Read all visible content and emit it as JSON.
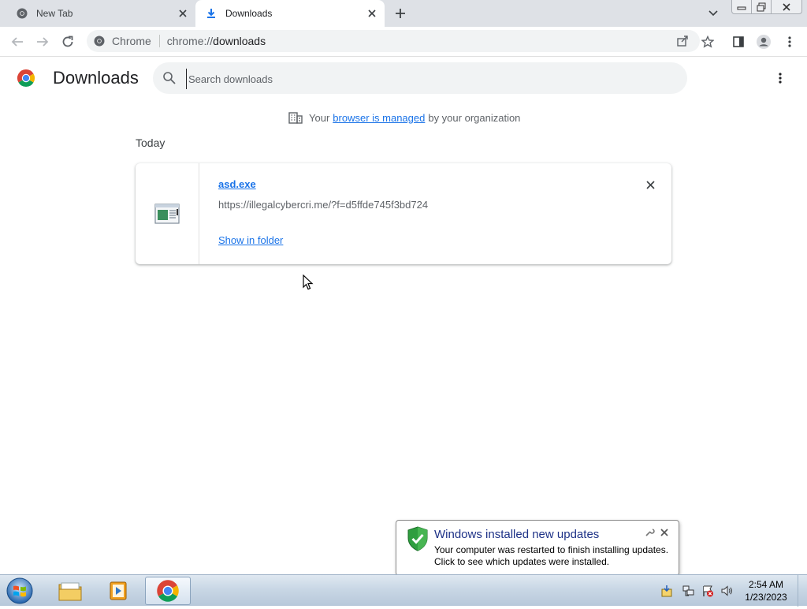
{
  "browser": {
    "tabs": [
      {
        "title": "New Tab",
        "icon": "chrome-icon",
        "active": false
      },
      {
        "title": "Downloads",
        "icon": "download-icon",
        "active": true
      }
    ],
    "new_tab_icon": "plus-icon",
    "tab_search_icon": "chevron-down-icon",
    "window_controls": [
      "minimize-icon",
      "restore-icon",
      "close-icon"
    ]
  },
  "toolbar": {
    "back_icon": "back-arrow-icon",
    "forward_icon": "forward-arrow-icon",
    "reload_icon": "reload-icon",
    "site_chip": "Chrome",
    "url_scheme": "chrome://",
    "url_host": "downloads",
    "right_icons": [
      "share-icon",
      "star-icon",
      "side-panel-icon",
      "profile-icon",
      "kebab-menu-icon"
    ]
  },
  "downloads_page": {
    "title": "Downloads",
    "search_placeholder": "Search downloads",
    "managed_notice": {
      "prefix": "Your",
      "link": "browser is managed",
      "suffix": "by your organization"
    },
    "date_group": "Today",
    "items": [
      {
        "file_name": "asd.exe",
        "url": "https://illegalcybercri.me/?f=d5ffde745f3bd724",
        "action": "Show in folder"
      }
    ]
  },
  "notification": {
    "title": "Windows installed new updates",
    "line1": "Your computer was restarted to finish installing updates.",
    "line2": "Click to see which updates were installed.",
    "icon": "shield-check-icon"
  },
  "taskbar": {
    "start": "windows-start-icon",
    "pinned": [
      "file-explorer-icon",
      "media-player-icon",
      "chrome-icon"
    ],
    "tray": [
      "action-center-icon",
      "network-icon",
      "flag-alert-icon",
      "volume-icon"
    ],
    "clock": {
      "time": "2:54 AM",
      "date": "1/23/2023"
    }
  },
  "colors": {
    "link": "#1a73e8",
    "tabstrip": "#dee1e6",
    "omnibox": "#f1f3f4",
    "notification_title": "#1e3287"
  }
}
